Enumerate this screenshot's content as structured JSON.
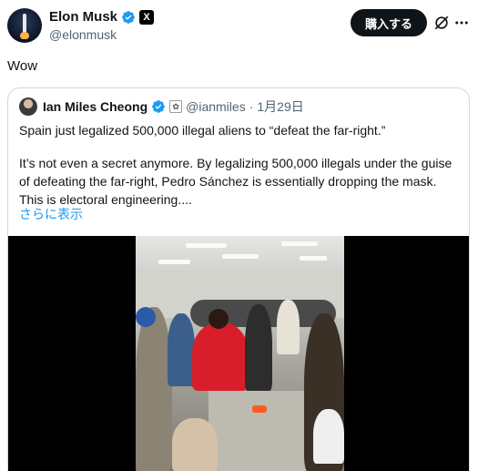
{
  "author": {
    "display_name": "Elon Musk",
    "handle": "@elonmusk",
    "x_badge": "X",
    "verified_color": "#1d9bf0"
  },
  "header": {
    "subscribe_label": "購入する",
    "grok_icon": "grok-icon",
    "more_icon": "more-icon"
  },
  "tweet": {
    "text": "Wow"
  },
  "quote": {
    "display_name": "Ian Miles Cheong",
    "handle": "@ianmiles",
    "separator": "·",
    "date": "1月29日",
    "affiliate_badge": "affiliate-badge-icon",
    "paragraph1": "Spain just legalized 500,000 illegal aliens to “defeat the far-right.”",
    "paragraph2": "It’s not even a secret anymore. By legalizing 500,000 illegals under the guise of defeating the far-right, Pedro Sánchez is essentially dropping the mask. This is electoral engineering....",
    "show_more": "さらに表示"
  },
  "media": {
    "type": "video",
    "description_icon": "video-thumbnail"
  },
  "colors": {
    "link": "#1d9bf0",
    "secondary_text": "#536471",
    "border": "#cfd9de",
    "button_bg": "#0f1419"
  }
}
